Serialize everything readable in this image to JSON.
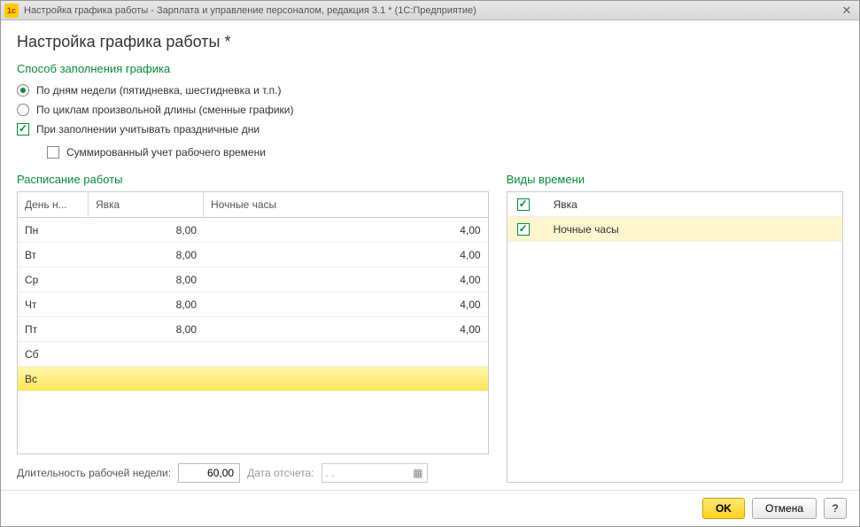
{
  "window": {
    "title": "Настройка графика работы - Зарплата и управление персоналом, редакция 3.1 * (1С:Предприятие)"
  },
  "page_title": "Настройка графика работы *",
  "fill_method": {
    "heading": "Способ заполнения графика",
    "by_weekdays_label": "По дням недели (пятидневка, шестидневка и т.п.)",
    "by_cycles_label": "По циклам произвольной длины (сменные графики)",
    "holidays_label": "При заполнении учитывать праздничные дни",
    "summarized_label": "Суммированный учет рабочего времени"
  },
  "schedule": {
    "heading": "Расписание работы",
    "col_day": "День н...",
    "col_attendance": "Явка",
    "col_night": "Ночные часы",
    "rows": [
      {
        "day": "Пн",
        "att": "8,00",
        "night": "4,00"
      },
      {
        "day": "Вт",
        "att": "8,00",
        "night": "4,00"
      },
      {
        "day": "Ср",
        "att": "8,00",
        "night": "4,00"
      },
      {
        "day": "Чт",
        "att": "8,00",
        "night": "4,00"
      },
      {
        "day": "Пт",
        "att": "8,00",
        "night": "4,00"
      },
      {
        "day": "Сб",
        "att": "",
        "night": ""
      },
      {
        "day": "Вс",
        "att": "",
        "night": ""
      }
    ]
  },
  "time_types": {
    "heading": "Виды времени",
    "rows": [
      {
        "label": "Явка"
      },
      {
        "label": "Ночные часы"
      }
    ]
  },
  "bottom": {
    "week_length_label": "Длительность рабочей недели:",
    "week_length_value": "60,00",
    "date_label": "Дата отсчета:",
    "date_placeholder": " .  .  "
  },
  "footer": {
    "ok": "OK",
    "cancel": "Отмена",
    "help": "?"
  }
}
